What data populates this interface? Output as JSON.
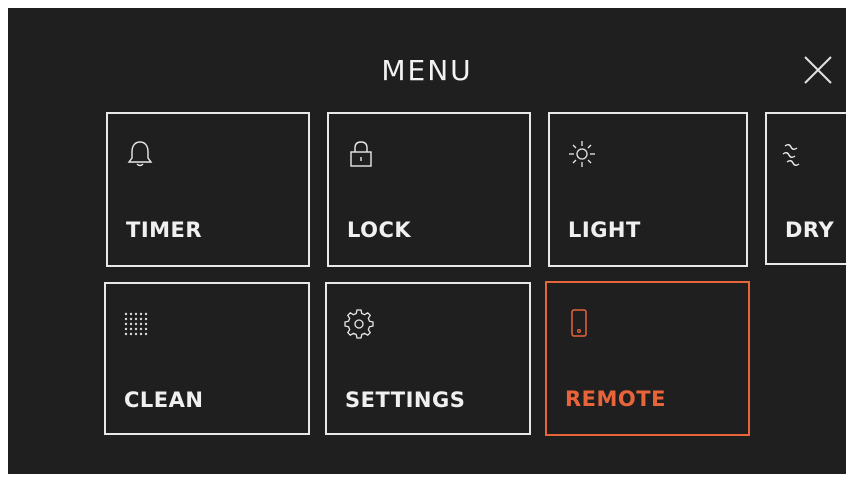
{
  "menu": {
    "title": "MENU",
    "close_icon": "close-icon",
    "accent_color": "#e8643a",
    "tiles": [
      {
        "label": "TIMER",
        "icon": "bell-icon"
      },
      {
        "label": "LOCK",
        "icon": "lock-icon"
      },
      {
        "label": "LIGHT",
        "icon": "sun-icon"
      },
      {
        "label": "DRY",
        "icon": "dry-waves-icon"
      },
      {
        "label": "CLEAN",
        "icon": "dots-grid-icon"
      },
      {
        "label": "SETTINGS",
        "icon": "gear-icon"
      },
      {
        "label": "REMOTE",
        "icon": "phone-icon",
        "selected": true
      }
    ]
  }
}
